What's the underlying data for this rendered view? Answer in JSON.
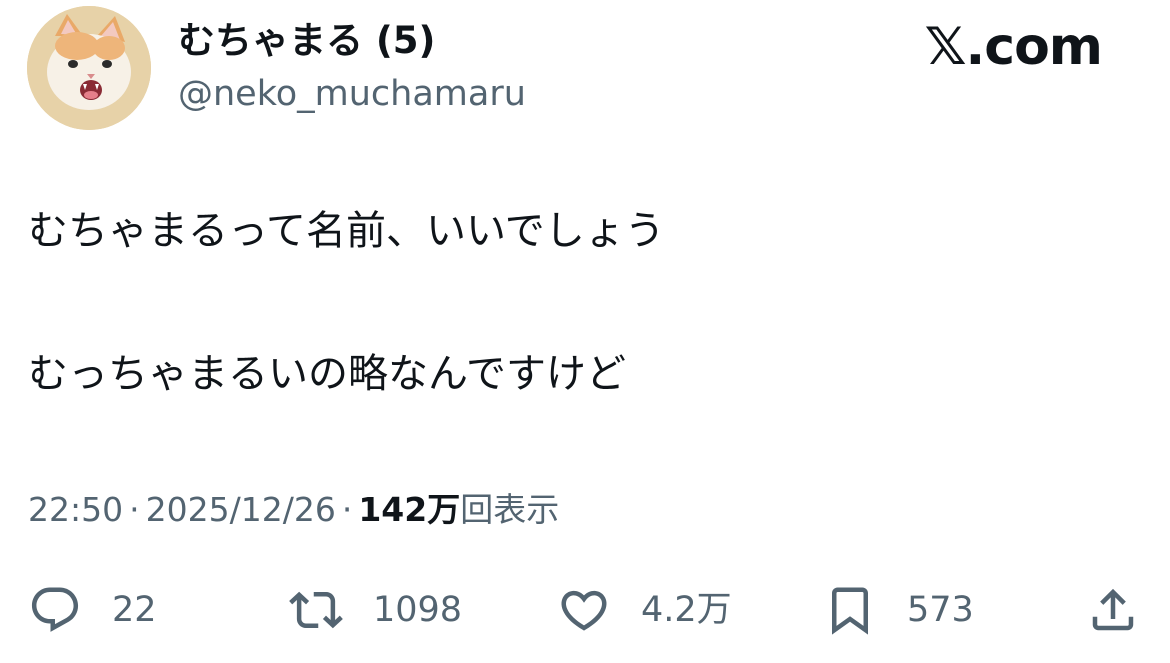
{
  "author": {
    "display_name": "むちゃまる (5)",
    "handle": "@neko_muchamaru",
    "avatar_icon": "cat-avatar"
  },
  "brand": {
    "label": "𝕏.com"
  },
  "tweet": {
    "lines": [
      "むちゃまるって名前、いいでしょう",
      "むっちゃまるいの略なんですけど"
    ]
  },
  "meta": {
    "time": "22:50",
    "separator": "·",
    "date": "2025/12/26",
    "views_count": "142万",
    "views_label": "回表示"
  },
  "actions": {
    "reply": {
      "icon": "reply-icon",
      "count": "22"
    },
    "retweet": {
      "icon": "retweet-icon",
      "count": "1098"
    },
    "like": {
      "icon": "heart-icon",
      "count": "4.2万"
    },
    "bookmark": {
      "icon": "bookmark-icon",
      "count": "573"
    },
    "share": {
      "icon": "share-icon"
    }
  },
  "colors": {
    "text_primary": "#0f1419",
    "text_secondary": "#536471",
    "background": "#ffffff"
  }
}
